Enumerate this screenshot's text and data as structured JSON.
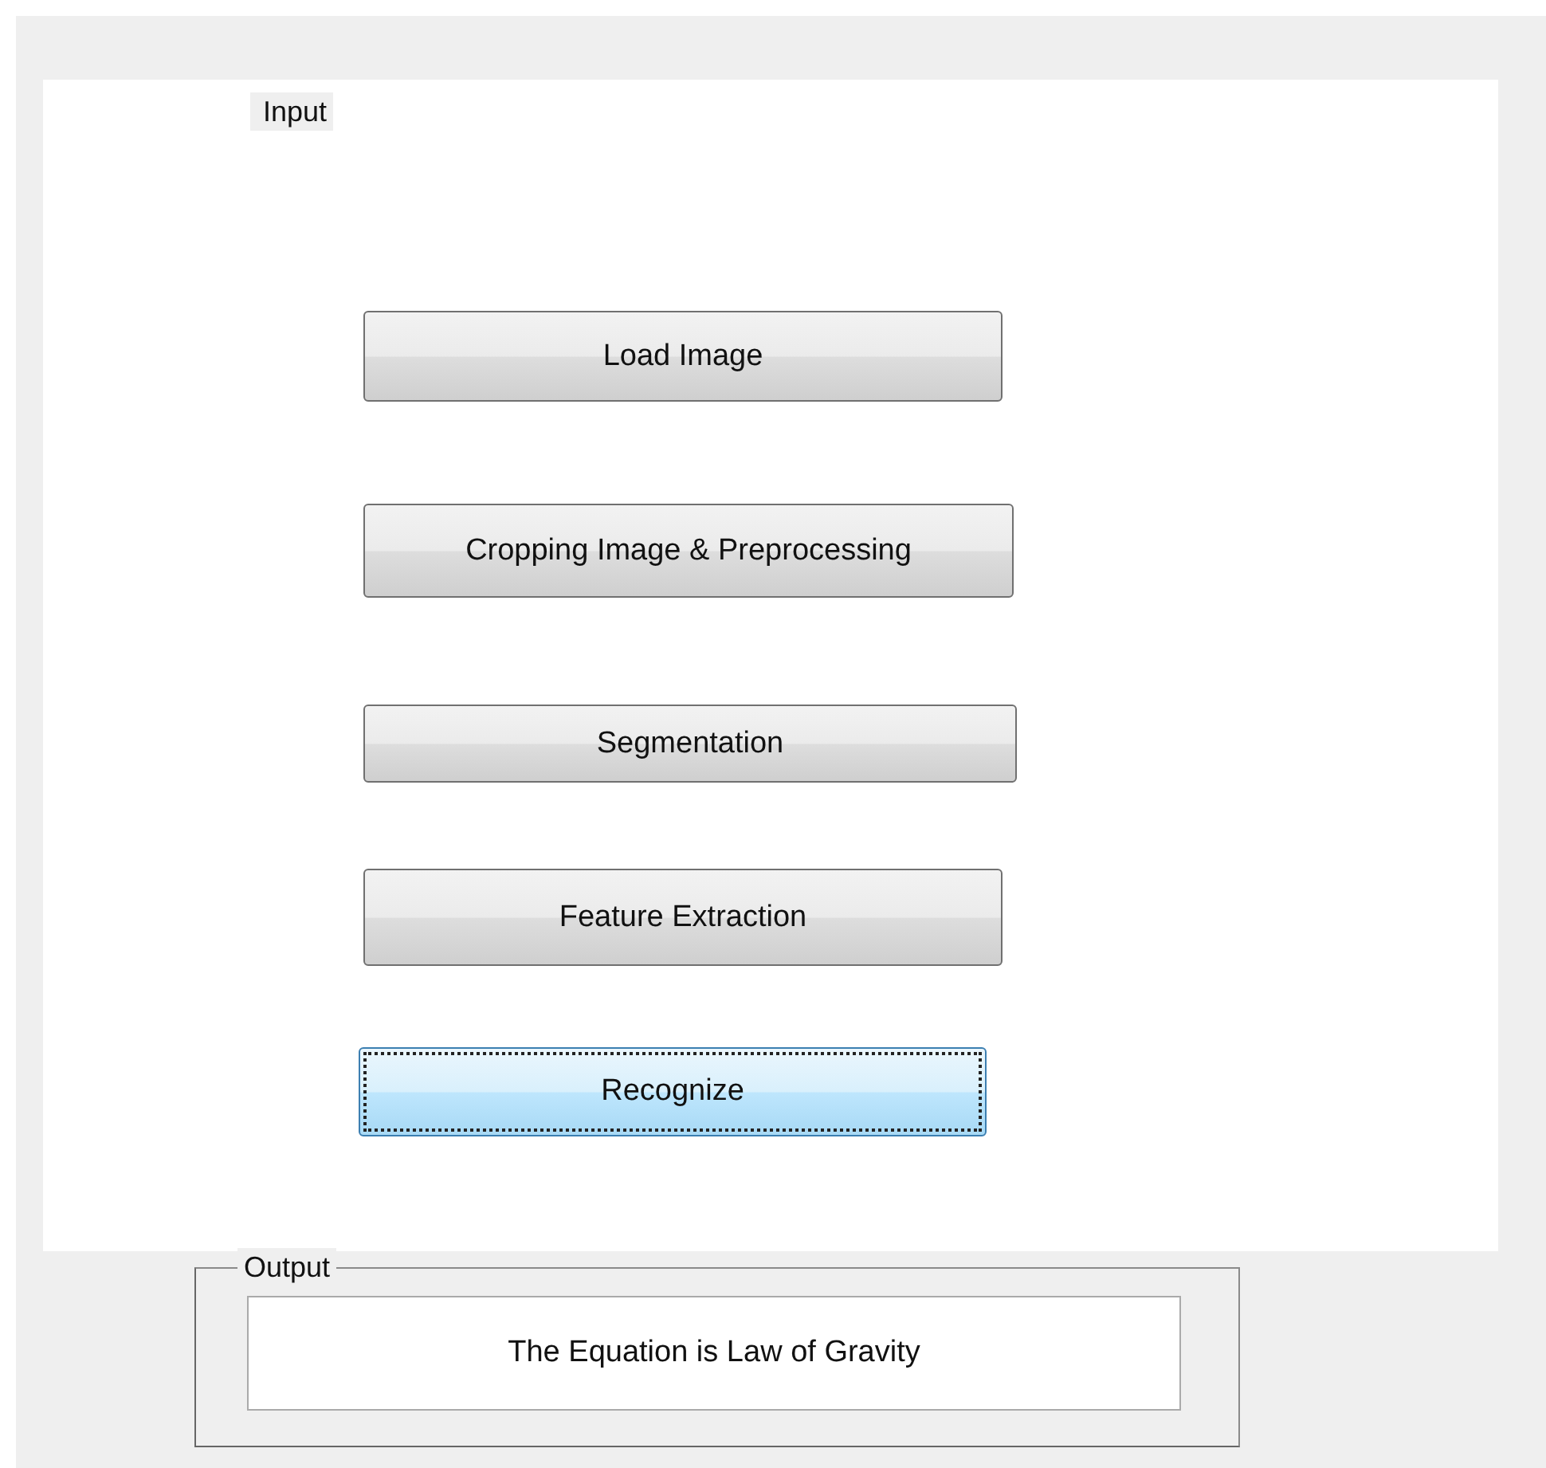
{
  "input_panel": {
    "title": "Input",
    "buttons": [
      {
        "label": "Load Image",
        "focused": false
      },
      {
        "label": "Cropping Image & Preprocessing",
        "focused": false
      },
      {
        "label": "Segmentation",
        "focused": false
      },
      {
        "label": "Feature Extraction",
        "focused": false
      },
      {
        "label": "Recognize",
        "focused": true
      }
    ]
  },
  "output_panel": {
    "title": "Output",
    "result": "The Equation is Law of Gravity"
  }
}
